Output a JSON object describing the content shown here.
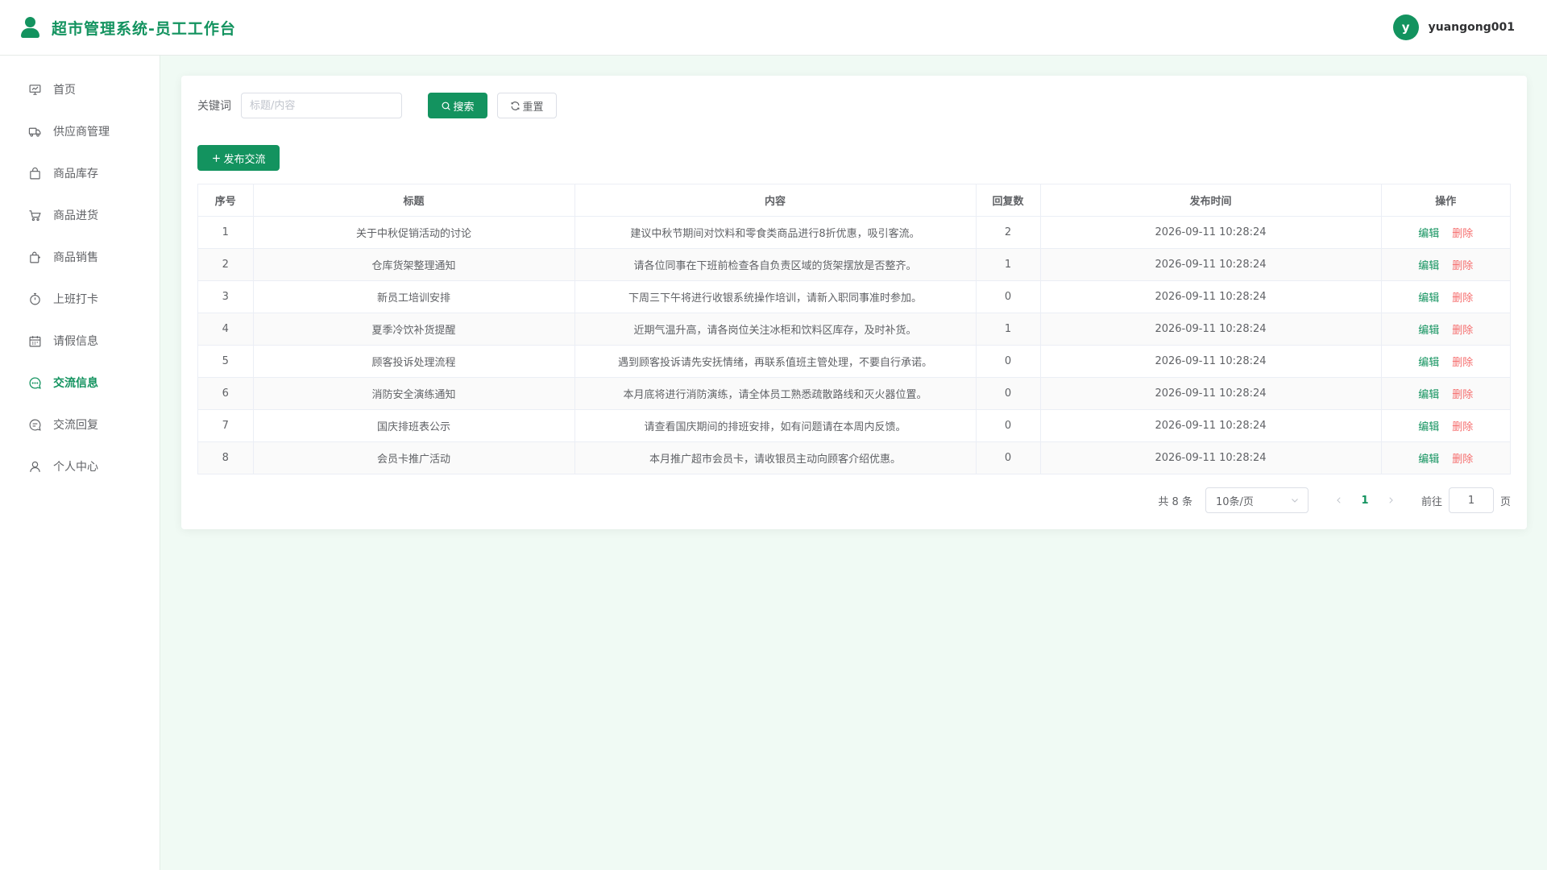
{
  "header": {
    "title": "超市管理系统-员工工作台",
    "avatar_letter": "y",
    "username": "yuangong001"
  },
  "sidebar": {
    "items": [
      {
        "label": "首页",
        "icon": "home-icon",
        "active": false
      },
      {
        "label": "供应商管理",
        "icon": "truck-icon",
        "active": false
      },
      {
        "label": "商品库存",
        "icon": "bag-icon",
        "active": false
      },
      {
        "label": "商品进货",
        "icon": "cart-icon",
        "active": false
      },
      {
        "label": "商品销售",
        "icon": "sale-bag-icon",
        "active": false
      },
      {
        "label": "上班打卡",
        "icon": "stopwatch-icon",
        "active": false
      },
      {
        "label": "请假信息",
        "icon": "calendar-icon",
        "active": false
      },
      {
        "label": "交流信息",
        "icon": "chat-dots-icon",
        "active": true
      },
      {
        "label": "交流回复",
        "icon": "chat-line-icon",
        "active": false
      },
      {
        "label": "个人中心",
        "icon": "user-icon",
        "active": false
      }
    ]
  },
  "search": {
    "label": "关键词",
    "value": "",
    "placeholder": "标题/内容",
    "search_label": "搜索",
    "reset_label": "重置"
  },
  "toolbar": {
    "add_label": "发布交流"
  },
  "table": {
    "columns": [
      "序号",
      "标题",
      "内容",
      "回复数",
      "发布时间",
      "操作"
    ],
    "edit_label": "编辑",
    "delete_label": "删除",
    "rows": [
      {
        "index": "1",
        "title": "关于中秋促销活动的讨论",
        "content": "建议中秋节期间对饮料和零食类商品进行8折优惠，吸引客流。",
        "replies": "2",
        "time": "2026-09-11 10:28:24"
      },
      {
        "index": "2",
        "title": "仓库货架整理通知",
        "content": "请各位同事在下班前检查各自负责区域的货架摆放是否整齐。",
        "replies": "1",
        "time": "2026-09-11 10:28:24"
      },
      {
        "index": "3",
        "title": "新员工培训安排",
        "content": "下周三下午将进行收银系统操作培训，请新入职同事准时参加。",
        "replies": "0",
        "time": "2026-09-11 10:28:24"
      },
      {
        "index": "4",
        "title": "夏季冷饮补货提醒",
        "content": "近期气温升高，请各岗位关注冰柜和饮料区库存，及时补货。",
        "replies": "1",
        "time": "2026-09-11 10:28:24"
      },
      {
        "index": "5",
        "title": "顾客投诉处理流程",
        "content": "遇到顾客投诉请先安抚情绪，再联系值班主管处理，不要自行承诺。",
        "replies": "0",
        "time": "2026-09-11 10:28:24"
      },
      {
        "index": "6",
        "title": "消防安全演练通知",
        "content": "本月底将进行消防演练，请全体员工熟悉疏散路线和灭火器位置。",
        "replies": "0",
        "time": "2026-09-11 10:28:24"
      },
      {
        "index": "7",
        "title": "国庆排班表公示",
        "content": "请查看国庆期间的排班安排，如有问题请在本周内反馈。",
        "replies": "0",
        "time": "2026-09-11 10:28:24"
      },
      {
        "index": "8",
        "title": "会员卡推广活动",
        "content": "本月推广超市会员卡，请收银员主动向顾客介绍优惠。",
        "replies": "0",
        "time": "2026-09-11 10:28:24"
      }
    ]
  },
  "pagination": {
    "total_label": "共 8 条",
    "page_size": "10条/页",
    "current_page": "1",
    "goto_label": "前往",
    "goto_value": "1",
    "page_suffix": "页"
  },
  "colors": {
    "primary": "#13935f",
    "danger": "#f56c6c",
    "page_background": "#f0faf4"
  }
}
